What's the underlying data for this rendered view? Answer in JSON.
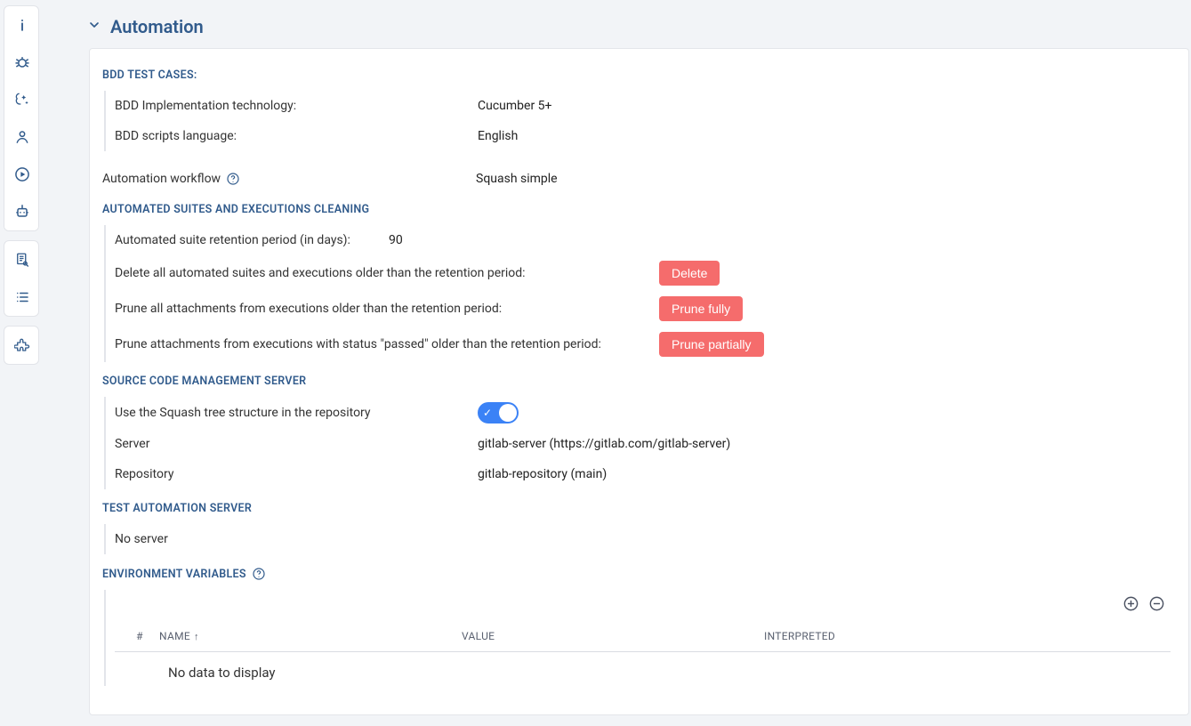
{
  "header": {
    "title": "Automation"
  },
  "sections": {
    "bdd": {
      "heading": "BDD TEST CASES:",
      "impl_label": "BDD Implementation technology:",
      "impl_value": "Cucumber 5+",
      "lang_label": "BDD scripts language:",
      "lang_value": "English"
    },
    "workflow": {
      "label": "Automation workflow",
      "value": "Squash simple"
    },
    "cleaning": {
      "heading": "AUTOMATED SUITES AND EXECUTIONS CLEANING",
      "retention_label": "Automated suite retention period (in days):",
      "retention_value": "90",
      "delete_label": "Delete all automated suites and executions older than the retention period:",
      "delete_btn": "Delete",
      "prune_full_label": "Prune all attachments from executions older than the retention period:",
      "prune_full_btn": "Prune fully",
      "prune_partial_label": "Prune attachments from executions with status \"passed\" older than the retention period:",
      "prune_partial_btn": "Prune partially"
    },
    "scm": {
      "heading": "SOURCE CODE MANAGEMENT SERVER",
      "use_tree_label": "Use the Squash tree structure in the repository",
      "use_tree_on": true,
      "server_label": "Server",
      "server_value": "gitlab-server (https://gitlab.com/gitlab-server)",
      "repo_label": "Repository",
      "repo_value": "gitlab-repository (main)"
    },
    "tas": {
      "heading": "TEST AUTOMATION SERVER",
      "no_server": "No server"
    },
    "env": {
      "heading": "ENVIRONMENT VARIABLES",
      "cols": {
        "num": "#",
        "name": "NAME",
        "value": "VALUE",
        "interpreted": "INTERPRETED"
      },
      "empty": "No data to display"
    }
  }
}
